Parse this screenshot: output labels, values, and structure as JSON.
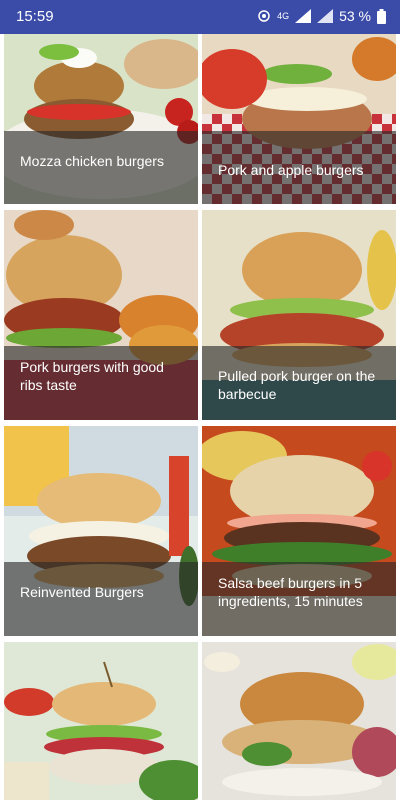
{
  "status": {
    "time": "15:59",
    "network": "4G",
    "battery": "53 %"
  },
  "recipes": [
    {
      "title": "Mozza chicken burgers"
    },
    {
      "title": "Pork and apple burgers"
    },
    {
      "title": "Pork burgers with good ribs taste"
    },
    {
      "title": "Pulled pork burger on the barbecue"
    },
    {
      "title": "Reinvented Burgers"
    },
    {
      "title": "Salsa beef burgers in 5 ingredients, 15 minutes"
    },
    {
      "title": ""
    },
    {
      "title": ""
    }
  ],
  "colors": {
    "statusbar": "#3a4ba8",
    "overlay": "rgba(40,40,40,0.62)"
  }
}
